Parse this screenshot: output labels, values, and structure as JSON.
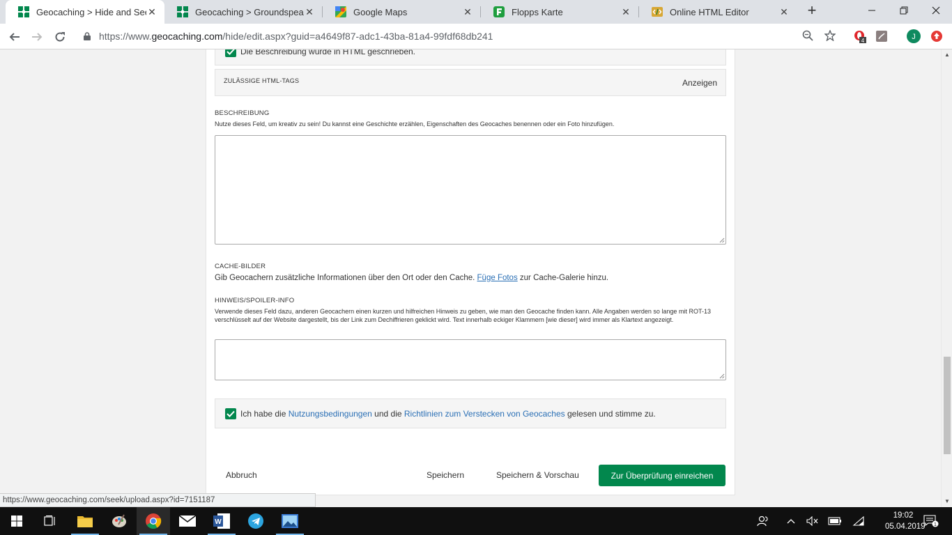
{
  "browser": {
    "tabs": [
      {
        "title": "Geocaching > Hide and Seek a",
        "icon": "geocaching-icon",
        "active": true
      },
      {
        "title": "Geocaching > Groundspeak - L",
        "icon": "geocaching-icon",
        "active": false
      },
      {
        "title": "Google Maps",
        "icon": "google-maps-icon",
        "active": false
      },
      {
        "title": "Flopps Karte",
        "icon": "flopps-icon",
        "active": false
      },
      {
        "title": "Online HTML Editor",
        "icon": "html-editor-icon",
        "active": false
      }
    ],
    "url_scheme": "https://www.",
    "url_host": "geocaching.com",
    "url_path": "/hide/edit.aspx?guid=a4649f87-adc1-43ba-81a4-99fdf68db241",
    "extension_badge": "4",
    "profile_initial": "J",
    "status_url": "https://www.geocaching.com/seek/upload.aspx?id=7151187"
  },
  "form": {
    "html_checkbox_label": "Die Beschreibung wurde in HTML geschrieben.",
    "html_tags_title": "ZULÄSSIGE HTML-TAGS",
    "html_tags_toggle": "Anzeigen",
    "description": {
      "title": "BESCHREIBUNG",
      "hint": "Nutze dieses Feld, um kreativ zu sein! Du kannst eine Geschichte erzählen, Eigenschaften des Geocaches benennen oder ein Foto hinzufügen.",
      "value": ""
    },
    "images": {
      "title": "CACHE-BILDER",
      "text_before": "Gib Geocachern zusätzliche Informationen über den Ort oder den Cache. ",
      "link": "Füge Fotos",
      "text_after": " zur Cache-Galerie hinzu."
    },
    "hint_section": {
      "title": "HINWEIS/SPOILER-INFO",
      "hint": "Verwende dieses Feld dazu, anderen Geocachern einen kurzen und hilfreichen Hinweis zu geben, wie man den Geocache finden kann. Alle Angaben werden so lange mit ROT-13 verschlüsselt auf der Website dargestellt, bis der Link zum Dechiffrieren geklickt wird. Text innerhalb eckiger Klammern [wie dieser] wird immer als Klartext angezeigt.",
      "value": ""
    },
    "terms": {
      "text_1": "Ich habe die ",
      "link_1": "Nutzungsbedingungen",
      "text_2": " und die ",
      "link_2": "Richtlinien zum Verstecken von Geocaches",
      "text_3": " gelesen und stimme zu.",
      "checked": true
    },
    "buttons": {
      "cancel": "Abbruch",
      "save": "Speichern",
      "save_preview": "Speichern & Vorschau",
      "submit": "Zur Überprüfung einreichen"
    }
  },
  "taskbar": {
    "time": "19:02",
    "date": "05.04.2019",
    "notification_count": "1"
  },
  "colors": {
    "brand_green": "#02874d",
    "link_blue": "#2a6fb5"
  }
}
